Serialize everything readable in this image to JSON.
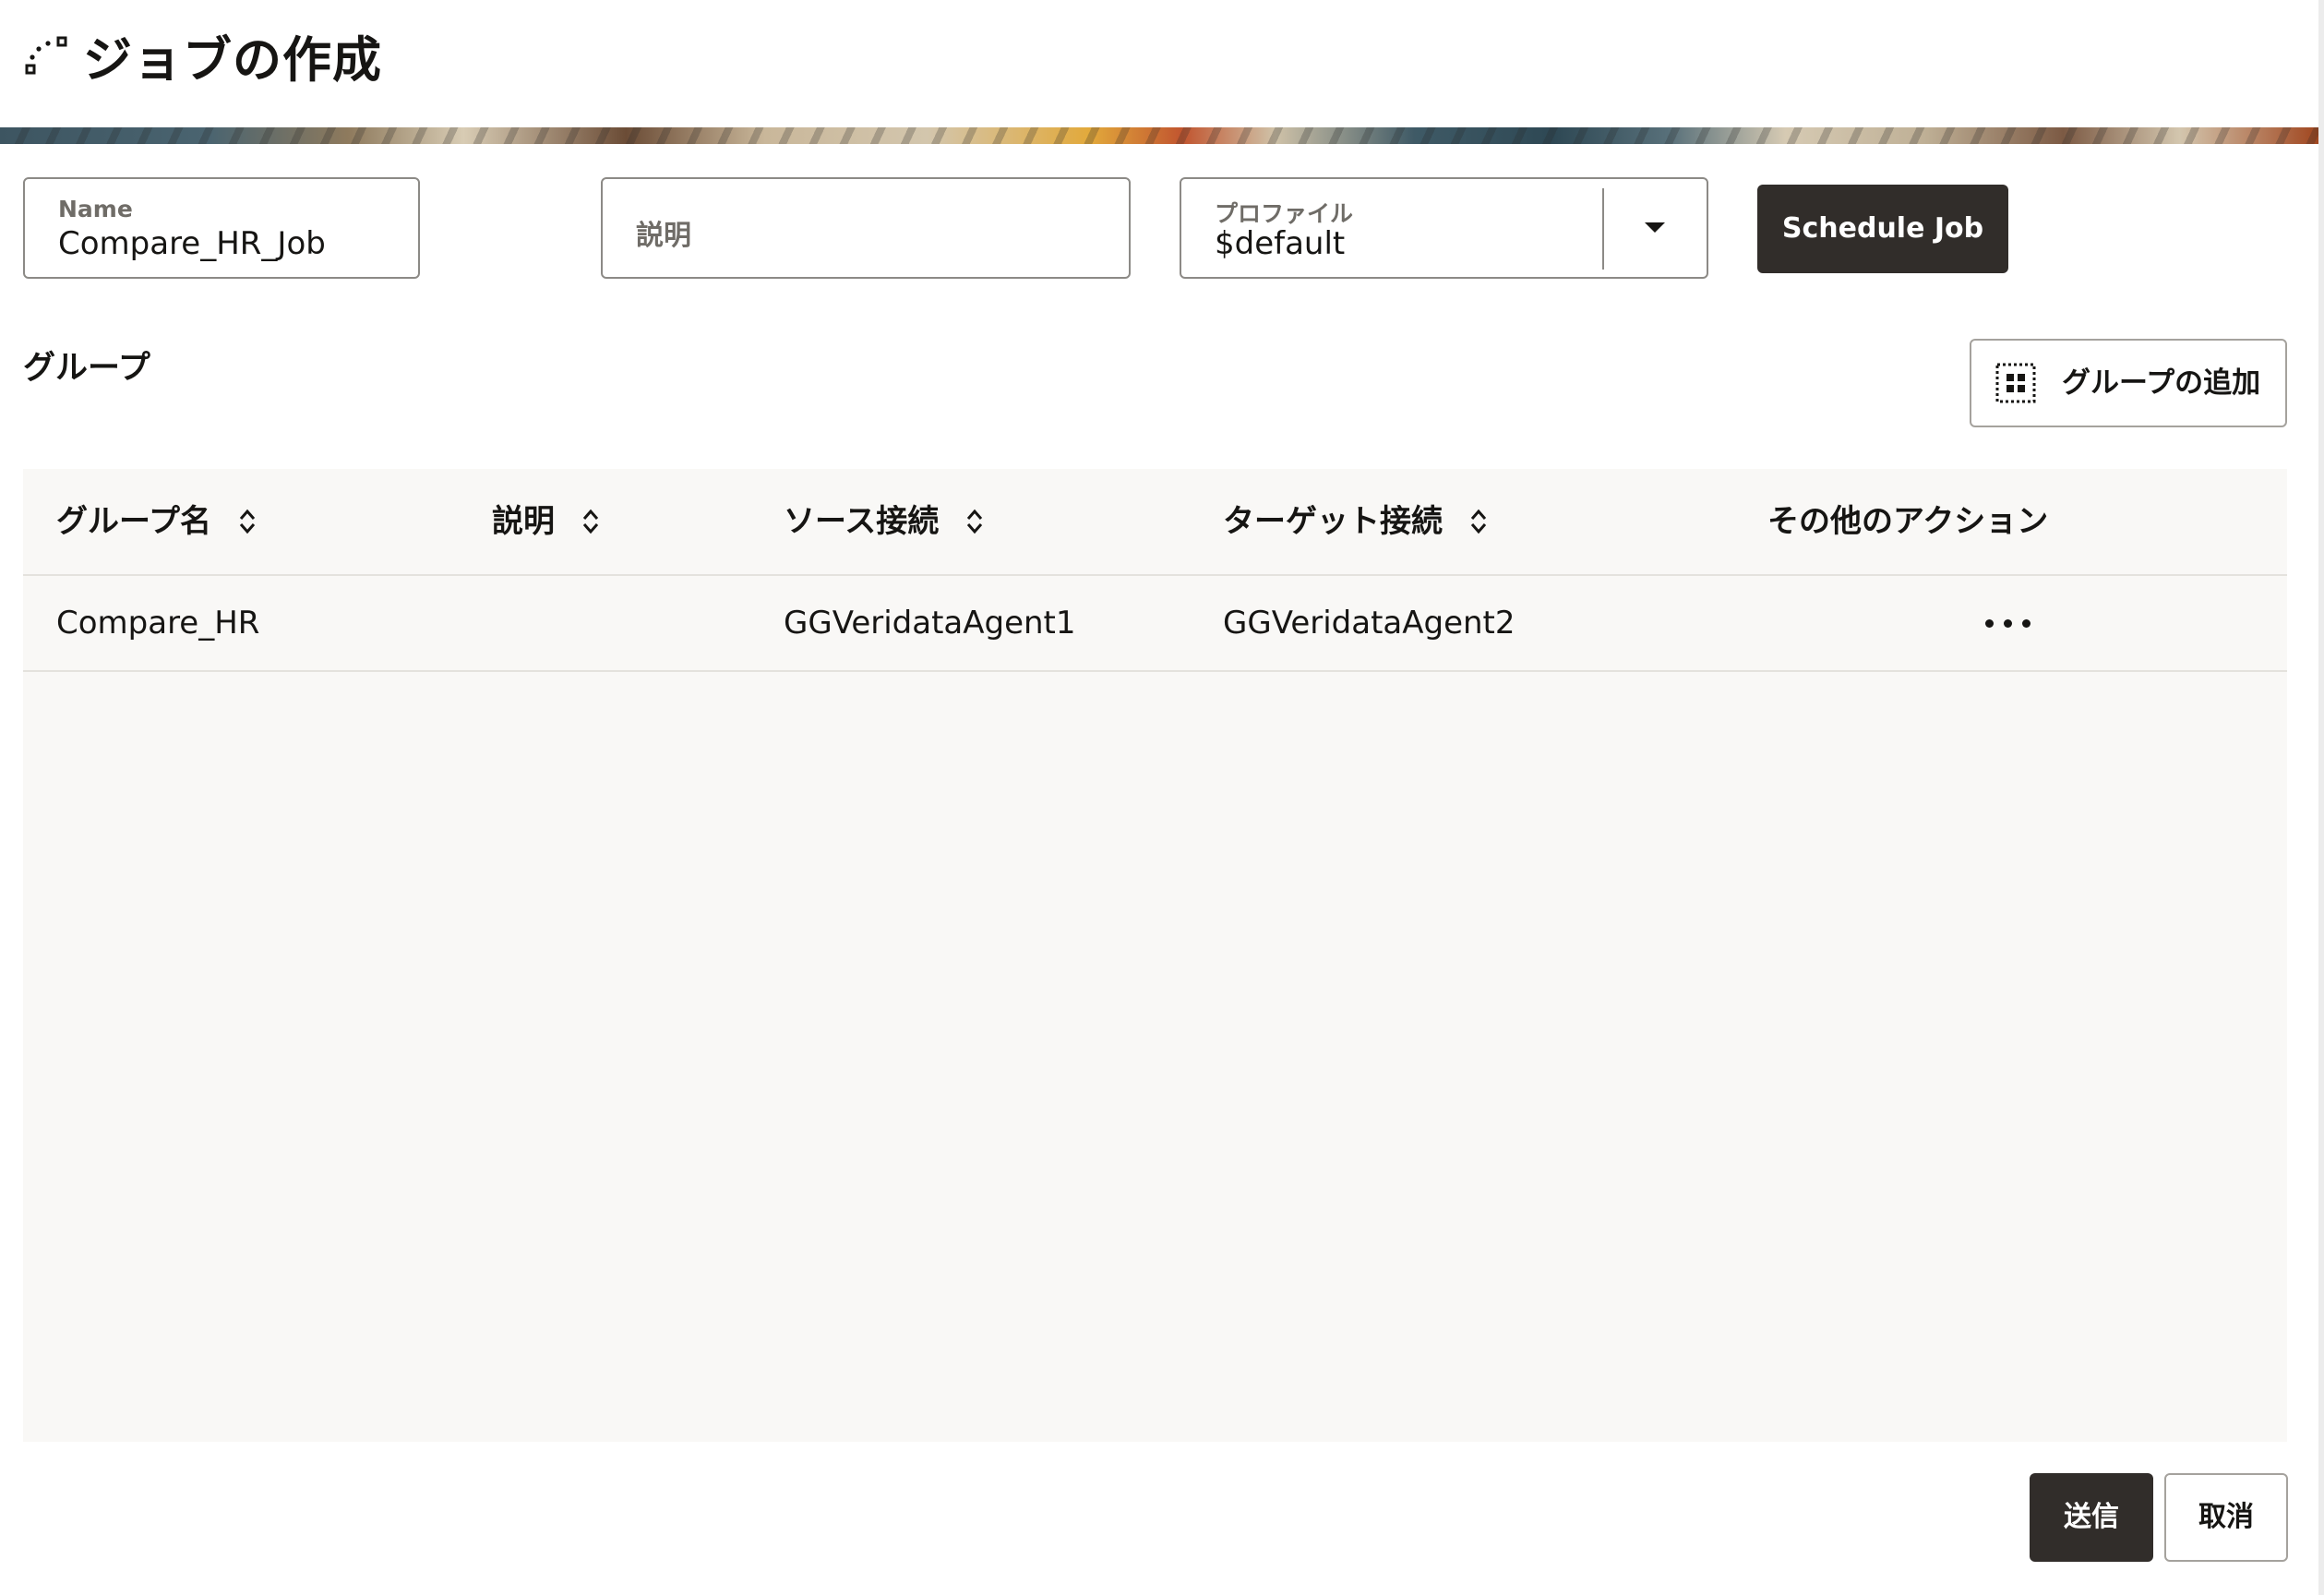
{
  "header": {
    "title": "ジョブの作成",
    "icon": "job-flow-icon"
  },
  "form": {
    "name": {
      "label": "Name",
      "value": "Compare_HR_Job"
    },
    "description": {
      "placeholder": "説明"
    },
    "profile": {
      "label": "プロファイル",
      "value": "$default"
    },
    "schedule_button": "Schedule Job"
  },
  "groups": {
    "title": "グループ",
    "add_button": "グループの追加",
    "columns": {
      "group_name": "グループ名",
      "description": "説明",
      "source": "ソース接続",
      "target": "ターゲット接続",
      "actions": "その他のアクション"
    },
    "rows": [
      {
        "group_name": "Compare_HR",
        "description": "",
        "source": "GGVeridataAgent1",
        "target": "GGVeridataAgent2"
      }
    ]
  },
  "footer": {
    "submit": "送信",
    "cancel": "取消"
  },
  "colors": {
    "primary_button": "#312d2a",
    "table_background": "#f9f8f6",
    "border": "#8c8a86"
  }
}
